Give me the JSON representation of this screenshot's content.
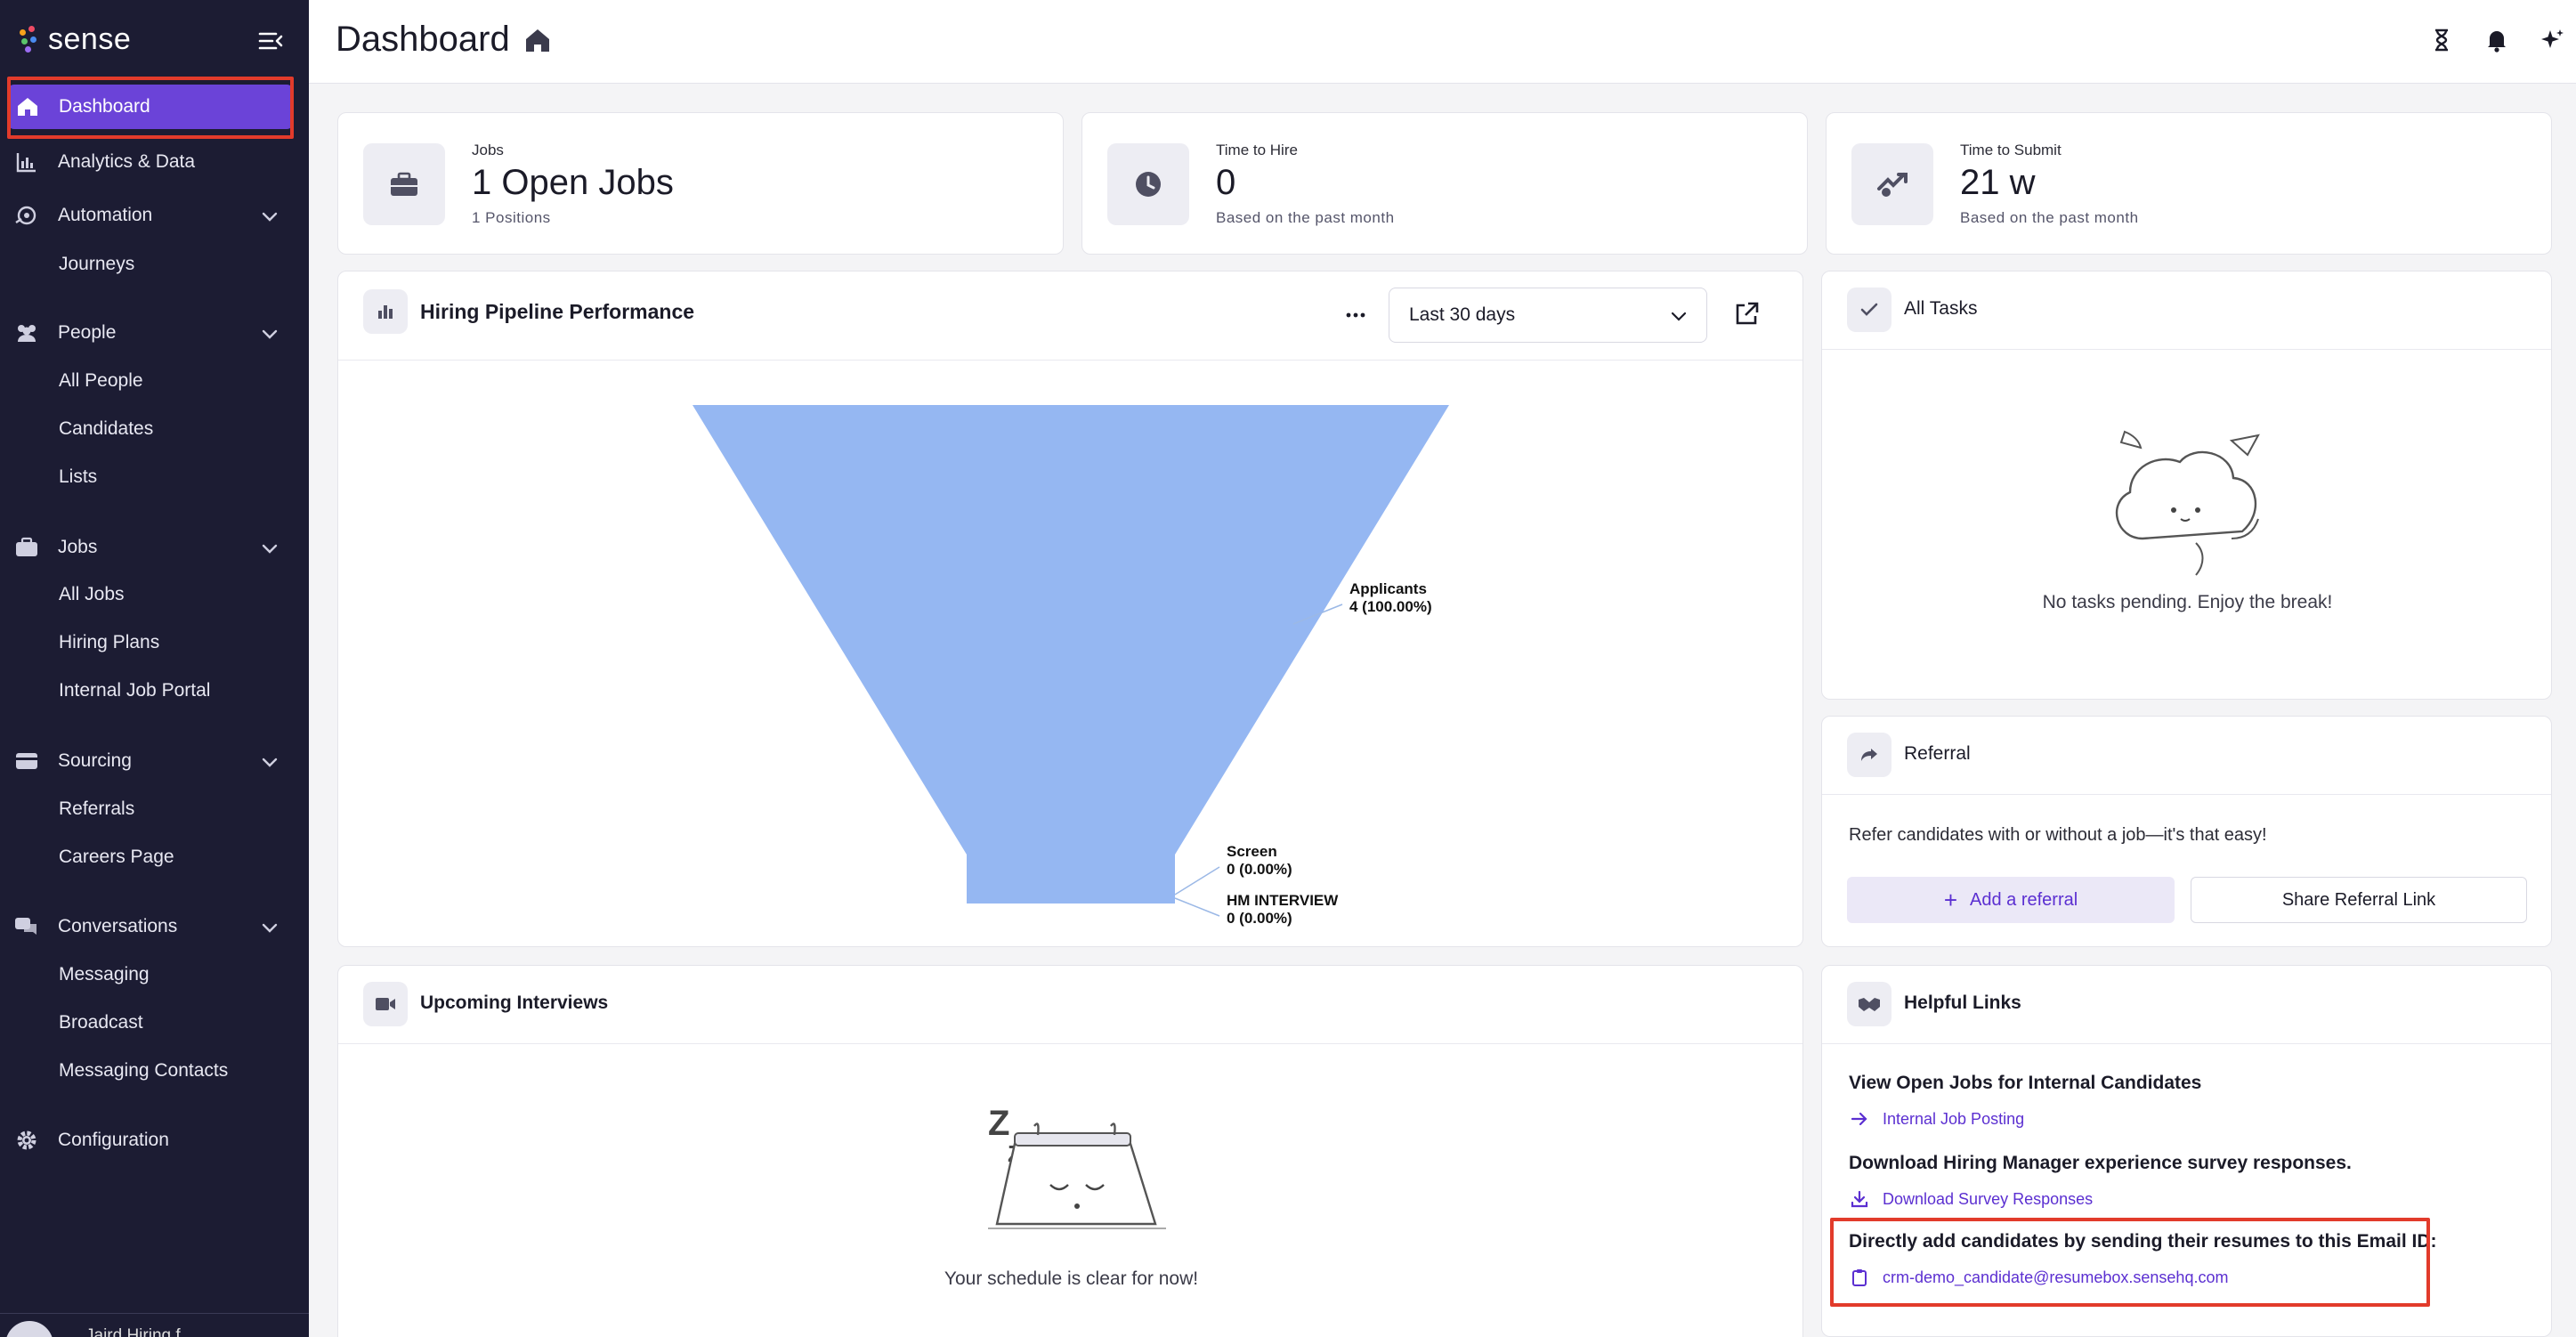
{
  "brand": {
    "name": "sense"
  },
  "sidebar": {
    "dashboard": "Dashboard",
    "analytics": "Analytics & Data",
    "automation": {
      "label": "Automation",
      "items": [
        "Journeys"
      ]
    },
    "people": {
      "label": "People",
      "items": [
        "All People",
        "Candidates",
        "Lists"
      ]
    },
    "jobs": {
      "label": "Jobs",
      "items": [
        "All Jobs",
        "Hiring Plans",
        "Internal Job Portal"
      ]
    },
    "sourcing": {
      "label": "Sourcing",
      "items": [
        "Referrals",
        "Careers Page"
      ]
    },
    "conversations": {
      "label": "Conversations",
      "items": [
        "Messaging",
        "Broadcast",
        "Messaging Contacts"
      ]
    },
    "configuration": "Configuration",
    "user_name": "Jaird Hiring f..."
  },
  "header": {
    "title": "Dashboard"
  },
  "stats": [
    {
      "label": "Jobs",
      "value": "1 Open Jobs",
      "sub": "1 Positions",
      "icon": "briefcase-icon"
    },
    {
      "label": "Time to Hire",
      "value": "0",
      "sub": "Based on the past month",
      "icon": "clock-icon"
    },
    {
      "label": "Time to Submit",
      "value": "21 w",
      "sub": "Based on the past month",
      "icon": "submit-icon"
    }
  ],
  "pipeline": {
    "title": "Hiring Pipeline Performance",
    "range": "Last 30 days"
  },
  "chart_data": {
    "type": "funnel",
    "categories": [
      "Applicants",
      "Screen",
      "HM INTERVIEW"
    ],
    "values": [
      4,
      0,
      0
    ],
    "labels": [
      "4 (100.00%)",
      "0 (0.00%)",
      "0 (0.00%)"
    ],
    "color": "#95b7f2"
  },
  "tasks": {
    "title": "All Tasks",
    "empty": "No tasks pending. Enjoy the break!"
  },
  "referral": {
    "title": "Referral",
    "text": "Refer candidates with or without a job—it's that easy!",
    "add_label": "Add a referral",
    "share_label": "Share Referral Link"
  },
  "interviews": {
    "title": "Upcoming Interviews",
    "empty": "Your schedule is clear for now!"
  },
  "links": {
    "title": "Helpful Links",
    "items": [
      {
        "heading": "View Open Jobs for Internal Candidates",
        "link": "Internal Job Posting"
      },
      {
        "heading": "Download Hiring Manager experience survey responses.",
        "link": "Download Survey Responses"
      },
      {
        "heading": "Directly add candidates by sending their resumes to this Email ID:",
        "link": "crm-demo_candidate@resumebox.sensehq.com"
      }
    ]
  },
  "colors": {
    "sidebar": "#1c1c33",
    "accent": "#6b43d8",
    "highlight": "#e23b2b",
    "funnel": "#95b7f2"
  }
}
